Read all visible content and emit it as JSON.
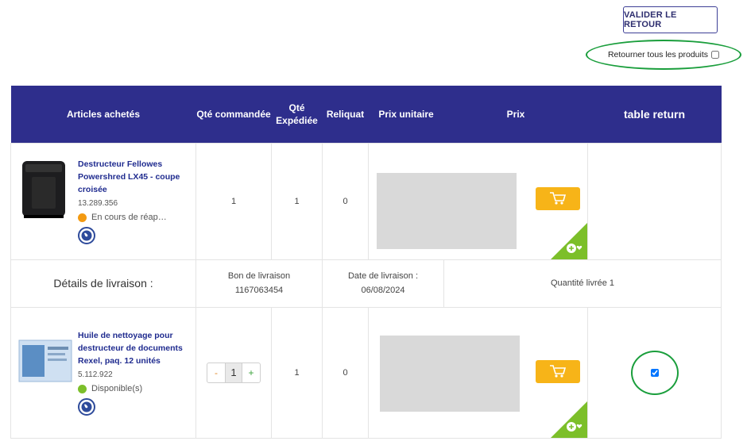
{
  "actions": {
    "validate_label": "VALIDER LE RETOUR",
    "return_all_label": "Retourner tous les produits"
  },
  "table": {
    "headers": {
      "articles": "Articles achetés",
      "qty_ordered": "Qté commandée",
      "qty_shipped": "Qté Expédiée",
      "remaining": "Reliquat",
      "unit_price": "Prix unitaire",
      "price": "Prix",
      "return": "table return"
    },
    "rows": [
      {
        "name": "Destructeur Fellowes Powershred LX45 - coupe croisée",
        "ref": "13.289.356",
        "status": "En cours de réap…",
        "status_color": "#f39a12",
        "qty_ordered": "1",
        "qty_shipped": "1",
        "remaining": "0"
      },
      {
        "name": "Huile de nettoyage pour destructeur de documents Rexel, paq. 12 unités",
        "ref": "5.112.922",
        "status": "Disponible(s)",
        "status_color": "#7cbf2a",
        "qty_ordered": "1",
        "qty_shipped": "1",
        "remaining": "0",
        "stepper_minus": "-",
        "stepper_plus": "+",
        "return_checked": true
      }
    ],
    "delivery": {
      "label": "Détails de livraison :",
      "bon_label": "Bon de livraison",
      "bon_value": "1167063454",
      "date_label": "Date de livraison :",
      "date_value": "06/08/2024",
      "qty_text": "Quantité livrée 1"
    }
  },
  "icons": {
    "cart": "cart-icon",
    "globe": "globe-icon",
    "wishlist": "add-wishlist-icon"
  },
  "colors": {
    "header_bg": "#2e2e8c",
    "cart_btn": "#f7b418",
    "wish_corner": "#7cbf2a",
    "highlight": "#1a9e3c"
  }
}
